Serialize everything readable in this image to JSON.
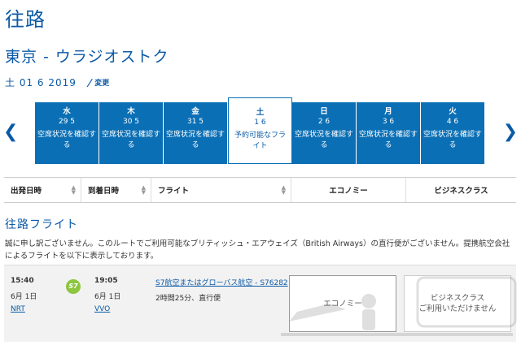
{
  "page": {
    "title": "往路",
    "route": "東京 - ウラジオストク",
    "date": "土 01 6 2019",
    "change_label": "変更"
  },
  "days": [
    {
      "dow": "水",
      "date": "29 5",
      "status": "空席状況を確認する",
      "selected": false
    },
    {
      "dow": "木",
      "date": "30 5",
      "status": "空席状況を確認する",
      "selected": false
    },
    {
      "dow": "金",
      "date": "31 5",
      "status": "空席状況を確認する",
      "selected": false
    },
    {
      "dow": "土",
      "date": "1 6",
      "status": "予約可能なフライト",
      "selected": true
    },
    {
      "dow": "日",
      "date": "2 6",
      "status": "空席状況を確認する",
      "selected": false
    },
    {
      "dow": "月",
      "date": "3 6",
      "status": "空席状況を確認する",
      "selected": false
    },
    {
      "dow": "火",
      "date": "4 6",
      "status": "空席状況を確認する",
      "selected": false
    }
  ],
  "columns": {
    "departure": "出発日時",
    "arrival": "到着日時",
    "flight": "フライト",
    "economy": "エコノミー",
    "business": "ビジネスクラス"
  },
  "section_title": "往路フライト",
  "notice": "誠に申し訳ございません。このルートでご利用可能なブリティッシュ・エアウェイズ（British Airways）の直行便がございません。提携航空会社によるフライトを以下に表示しております。",
  "flight": {
    "dep_time": "15:40",
    "dep_date": "6月 1日",
    "dep_airport": "NRT",
    "logo_text": "S7",
    "arr_time": "19:05",
    "arr_date": "6月 1日",
    "arr_airport": "VVO",
    "carrier": "S7航空またはグローバス航空 - S76282",
    "duration": "2時間25分、直行便",
    "economy": "エコノミー",
    "business": "ビジネスクラス",
    "business_status": "ご利用いただけません"
  },
  "colors": {
    "brand_blue": "#0b6fb5",
    "title_blue": "#0b5aa6",
    "s7_green": "#8dc63f"
  }
}
